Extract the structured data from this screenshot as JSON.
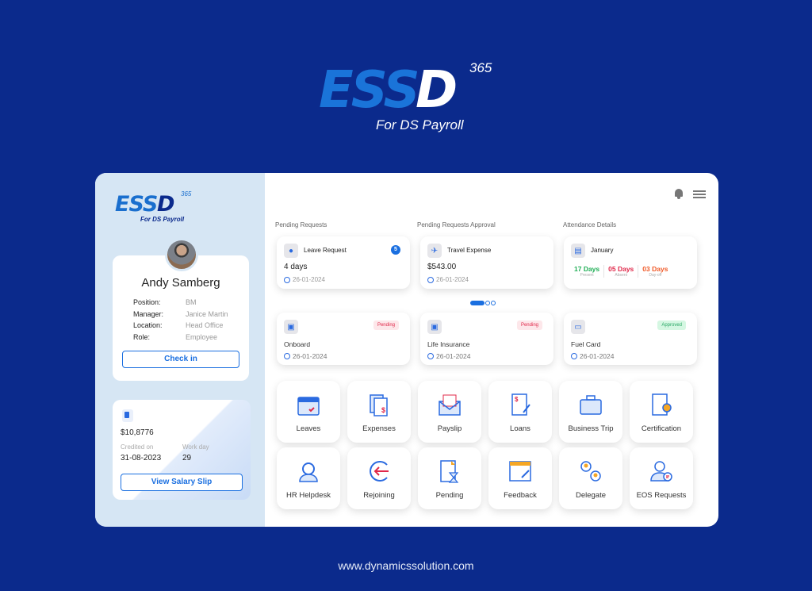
{
  "hero": {
    "logo_main": "ESS",
    "logo_d": "D",
    "logo_sup": "365",
    "logo_sub": "For DS Payroll"
  },
  "sidebar": {
    "logo_main": "ESS",
    "logo_d": "D",
    "logo_sup": "365",
    "logo_sub": "For DS Payroll",
    "profile": {
      "name": "Andy Samberg",
      "fields": [
        {
          "label": "Position:",
          "value": "BM"
        },
        {
          "label": "Manager:",
          "value": "Janice Martin"
        },
        {
          "label": "Location:",
          "value": "Head Office"
        },
        {
          "label": "Role:",
          "value": "Employee"
        }
      ],
      "checkin_label": "Check in"
    },
    "salary": {
      "amount": "$10,8776",
      "credited_label": "Credited on",
      "credited_value": "31-08-2023",
      "workday_label": "Work day",
      "workday_value": "29",
      "button_label": "View Salary Slip"
    }
  },
  "sections": {
    "pending_requests": "Pending Requests",
    "pending_approval": "Pending Requests Approval",
    "attendance": "Attendance Details"
  },
  "cards": {
    "leave": {
      "title": "Leave Request",
      "value": "4 days",
      "date": "26-01-2024",
      "badge": "5"
    },
    "travel": {
      "title": "Travel Expense",
      "value": "$543.00",
      "date": "26-01-2024"
    },
    "attendance": {
      "month": "January",
      "stats": [
        {
          "value": "17 Days",
          "label": "Present",
          "color": "#1fae55"
        },
        {
          "value": "05 Days",
          "label": "Absent",
          "color": "#e0284a"
        },
        {
          "value": "03 Days",
          "label": "Day-off",
          "color": "#f05a28"
        }
      ]
    }
  },
  "carousel": {
    "pages": 3,
    "active": 1
  },
  "requests": [
    {
      "title": "Onboard",
      "date": "26-01-2024",
      "status": "Pending"
    },
    {
      "title": "Life Insurance",
      "date": "26-01-2024",
      "status": "Pending"
    },
    {
      "title": "Fuel Card",
      "date": "26-01-2024",
      "status": "Approved"
    }
  ],
  "tiles": [
    {
      "label": "Leaves",
      "icon": "calendar-icon"
    },
    {
      "label": "Expenses",
      "icon": "expenses-icon"
    },
    {
      "label": "Payslip",
      "icon": "envelope-icon"
    },
    {
      "label": "Loans",
      "icon": "loan-document-icon"
    },
    {
      "label": "Business Trip",
      "icon": "briefcase-icon"
    },
    {
      "label": "Certification",
      "icon": "certificate-icon"
    },
    {
      "label": "HR Helpdesk",
      "icon": "headset-icon"
    },
    {
      "label": "Rejoining",
      "icon": "rejoin-arrow-icon"
    },
    {
      "label": "Pending",
      "icon": "hourglass-document-icon"
    },
    {
      "label": "Feedback",
      "icon": "feedback-icon"
    },
    {
      "label": "Delegate",
      "icon": "delegate-icon"
    },
    {
      "label": "EOS Requests",
      "icon": "eos-user-icon"
    }
  ],
  "footer": {
    "url": "www.dynamicssolution.com"
  }
}
